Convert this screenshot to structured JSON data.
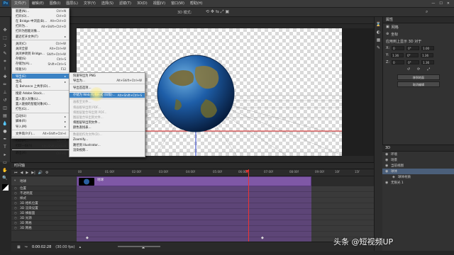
{
  "menubar": {
    "logo": "Ps",
    "items": [
      "文件(F)",
      "编辑(E)",
      "图像(I)",
      "图层(L)",
      "文字(Y)",
      "选择(S)",
      "滤镜(T)",
      "3D(D)",
      "视图(V)",
      "窗口(W)",
      "帮助(H)"
    ],
    "right_label": "3D 模式:"
  },
  "file_menu": {
    "items": [
      {
        "label": "新建(N)...",
        "shortcut": "Ctrl+N"
      },
      {
        "label": "打开(O)...",
        "shortcut": "Ctrl+O"
      },
      {
        "label": "在 Bridge 中浏览(B)...",
        "shortcut": "Alt+Ctrl+O"
      },
      {
        "label": "打开为...",
        "shortcut": "Alt+Shift+Ctrl+O"
      },
      {
        "label": "打开为智能对象...",
        "shortcut": ""
      },
      {
        "label": "最近打开文件(T)",
        "shortcut": ""
      },
      {
        "label": "关闭(C)",
        "shortcut": "Ctrl+W"
      },
      {
        "label": "关闭全部",
        "shortcut": "Alt+Ctrl+W"
      },
      {
        "label": "关闭并转到 Bridge...",
        "shortcut": "Shift+Ctrl+W"
      },
      {
        "label": "存储(S)",
        "shortcut": "Ctrl+S"
      },
      {
        "label": "存储为(A)...",
        "shortcut": "Shift+Ctrl+S"
      },
      {
        "label": "恢复(V)",
        "shortcut": "F12"
      },
      {
        "label": "导出(E)",
        "shortcut": ""
      },
      {
        "label": "生成",
        "shortcut": ""
      },
      {
        "label": "在 Behance 上共享(D)...",
        "shortcut": ""
      },
      {
        "label": "搜索 Adobe Stock...",
        "shortcut": ""
      },
      {
        "label": "置入嵌入对象(L)...",
        "shortcut": ""
      },
      {
        "label": "置入链接的智能对象(K)...",
        "shortcut": ""
      },
      {
        "label": "打包(G)...",
        "shortcut": ""
      },
      {
        "label": "自动(U)",
        "shortcut": ""
      },
      {
        "label": "脚本(R)",
        "shortcut": ""
      },
      {
        "label": "导入(M)",
        "shortcut": ""
      },
      {
        "label": "文件简介(F)...",
        "shortcut": "Alt+Shift+Ctrl+I"
      },
      {
        "label": "打印(P)...",
        "shortcut": "Ctrl+P"
      },
      {
        "label": "打印一份(Y)",
        "shortcut": "Alt+Shift+Ctrl+P"
      },
      {
        "label": "退出(X)",
        "shortcut": "Ctrl+Q"
      }
    ]
  },
  "export_menu": {
    "items": [
      {
        "label": "快速导出为 PNG",
        "shortcut": ""
      },
      {
        "label": "导出为...",
        "shortcut": "Alt+Shift+Ctrl+W"
      },
      {
        "label": "导出首选项...",
        "shortcut": ""
      },
      {
        "label": "存储为 Web 所用格式 (旧版)...",
        "shortcut": "Alt+Shift+Ctrl+S"
      },
      {
        "label": "画板至文件...",
        "shortcut": ""
      },
      {
        "label": "将画板导出到 PDF...",
        "shortcut": ""
      },
      {
        "label": "将图层复合导出到 PDF...",
        "shortcut": ""
      },
      {
        "label": "图层复合导出到文件...",
        "shortcut": ""
      },
      {
        "label": "将图层导出到文件...",
        "shortcut": ""
      },
      {
        "label": "颜色查找表...",
        "shortcut": ""
      },
      {
        "label": "数据组作为文件(D)...",
        "shortcut": ""
      },
      {
        "label": "Zoomify...",
        "shortcut": ""
      },
      {
        "label": "路径到 Illustrator...",
        "shortcut": ""
      },
      {
        "label": "渲染视频...",
        "shortcut": ""
      }
    ]
  },
  "properties": {
    "title": "属性",
    "row1": "网格",
    "row2": "坐标",
    "row3": "应用到上显示 3D 对于",
    "fields": [
      "0",
      "0°",
      "1.00",
      "1.36",
      "0°",
      "1.36",
      "0",
      "0°",
      "1.36"
    ],
    "buttons": [
      "移到地面",
      "取消编辑"
    ]
  },
  "layers": {
    "items": [
      "环境",
      "场景",
      "当前视图",
      "球体",
      "球体材质",
      "无限光 1"
    ]
  },
  "timeline": {
    "title": "时间轴",
    "clip_name": "地球",
    "ruler": [
      "00",
      "01:00f",
      "02:00f",
      "03:00f",
      "04:00f",
      "05:00f",
      "06:00f",
      "07:00f",
      "08:00f",
      "09:00f",
      "10f",
      "15f",
      "20f"
    ],
    "tracks": [
      "位置",
      "不透明度",
      "样式",
      "3D 相机位置",
      "3D 渲染设置",
      "3D 横截面",
      "3D 光源",
      "3D 网格",
      "3D 网格"
    ],
    "timecode": "0:00:02:28",
    "fps": "(30.00 fps)"
  },
  "watermark": "头条 @短视频UP"
}
